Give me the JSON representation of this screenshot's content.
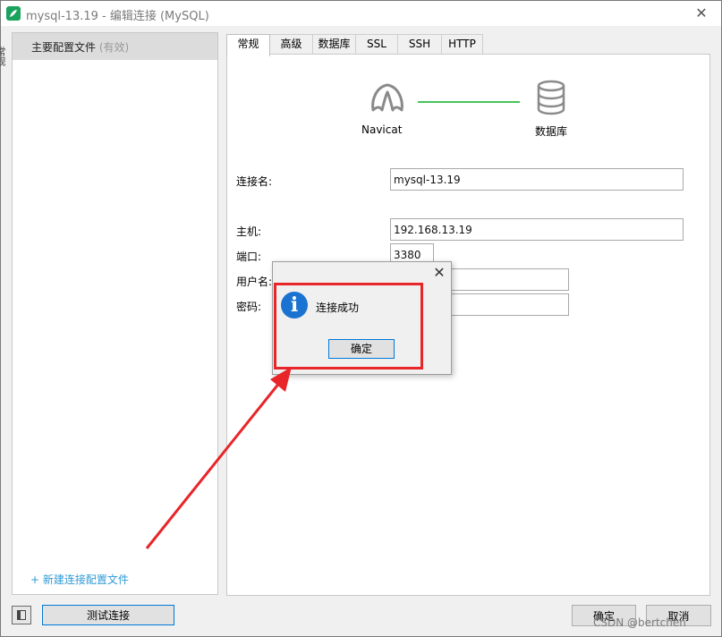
{
  "window": {
    "title": "mysql-13.19 - 编辑连接 (MySQL)",
    "close_glyph": "✕"
  },
  "sidebar": {
    "edge_text": "常规",
    "profile_name": "主要配置文件",
    "profile_status": "(有效)",
    "new_profile_link": "+ 新建连接配置文件"
  },
  "tabs": [
    {
      "label": "常规"
    },
    {
      "label": "高级"
    },
    {
      "label": "数据库"
    },
    {
      "label": "SSL"
    },
    {
      "label": "SSH"
    },
    {
      "label": "HTTP"
    }
  ],
  "diagram": {
    "navicat_label": "Navicat",
    "database_label": "数据库",
    "line_color": "#47c35a",
    "icons": [
      "navicat-logo-icon",
      "database-icon"
    ]
  },
  "form": {
    "connection_name": {
      "label": "连接名:",
      "value": "mysql-13.19"
    },
    "host": {
      "label": "主机:",
      "value": "192.168.13.19"
    },
    "port": {
      "label": "端口:",
      "value": "3380"
    },
    "username": {
      "label": "用户名:",
      "value": ""
    },
    "password": {
      "label": "密码:",
      "value": ""
    }
  },
  "footer": {
    "test_button": "测试连接",
    "ok_button": "确定",
    "cancel_button": "取消",
    "watermark": "CSDN @bertchen"
  },
  "dialog": {
    "message": "连接成功",
    "ok_button": "确定",
    "close_glyph": "✕",
    "info_glyph": "i",
    "annotation_color": "#e8262a"
  }
}
